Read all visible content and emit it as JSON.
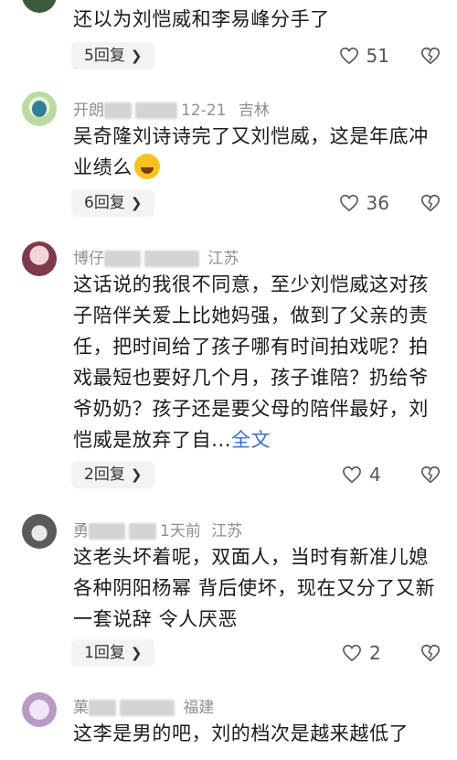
{
  "comments": [
    {
      "text": "还以为刘恺威和李易峰分手了",
      "reply_label": "5回复",
      "likes": "51"
    },
    {
      "meta_visible_a": "开朗",
      "meta_visible_b": "12-21",
      "location": "吉林",
      "text": "吴奇隆刘诗诗完了又刘恺威，这是年底冲业绩么",
      "reply_label": "6回复",
      "likes": "36"
    },
    {
      "meta_visible_a": "博仔",
      "location": "江苏",
      "text": "这话说的我很不同意，至少刘恺威这对孩子陪伴关爱上比她妈强，做到了父亲的责任，把时间给了孩子哪有时间拍戏呢？拍戏最短也要好几个月，孩子谁陪？扔给爷爷奶奶？孩子还是要父母的陪伴最好，刘恺威是放弃了自...",
      "more_label": "全文",
      "reply_label": "2回复",
      "likes": "4"
    },
    {
      "meta_visible_a": "勇",
      "meta_visible_b": "1天前",
      "location": "江苏",
      "text": "这老头坏着呢，双面人，当时有新准儿媳 各种阴阳杨幂 背后使坏，现在又分了又新一套说辞 令人厌恶",
      "reply_label": "1回复",
      "likes": "2"
    },
    {
      "meta_visible_a": "菓",
      "location": "福建",
      "text": "这李是男的吧，刘的档次是越来越低了"
    }
  ],
  "icons": {
    "like": "heart-outline-icon",
    "dislike": "broken-heart-icon",
    "chevron": "chevron-right-icon"
  },
  "colors": {
    "link": "#3b6cc4",
    "meta": "#8f8f8f",
    "reply_bg": "#f3f3f3"
  }
}
